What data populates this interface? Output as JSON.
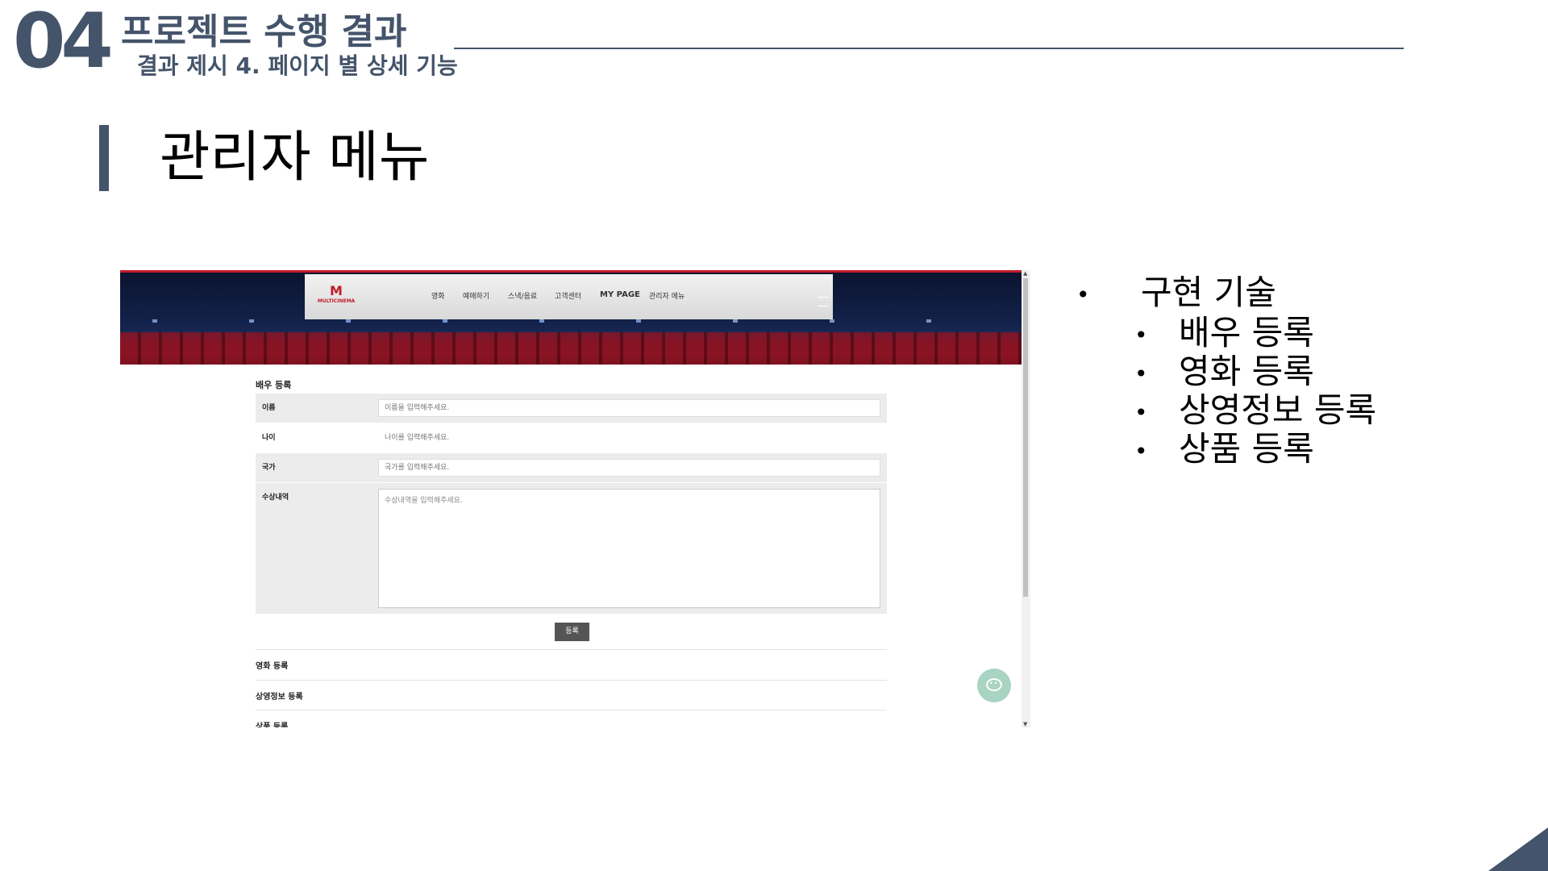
{
  "header": {
    "section_number": "04",
    "section_title": "프로젝트 수행 결과",
    "section_subtitle": "결과 제시 4. 페이지 별 상세 기능"
  },
  "slide_title": "관리자 메뉴",
  "screenshot": {
    "logo_mark": "M",
    "logo_text": "MULTICINEMA",
    "nav": [
      "영화",
      "예매하기",
      "스낵/음료",
      "고객센터",
      "MY PAGE",
      "관리자 메뉴"
    ],
    "form_title": "배우 등록",
    "fields": [
      {
        "label": "이름",
        "placeholder": "이름을 입력해주세요."
      },
      {
        "label": "나이",
        "placeholder": "나이를 입력해주세요."
      },
      {
        "label": "국가",
        "placeholder": "국가를 입력해주세요."
      },
      {
        "label": "수상내역",
        "placeholder": "수상내역을 입력해주세요."
      }
    ],
    "submit_label": "등록",
    "sections": [
      "영화 등록",
      "상영정보 등록",
      "상품 등록"
    ],
    "scroll_up": "▲",
    "scroll_down": "▼",
    "chat_dots": "•••"
  },
  "bullets": {
    "heading": "구현 기술",
    "items": [
      "배우 등록",
      "영화 등록",
      "상영정보 등록",
      "상품 등록"
    ],
    "marker": "•"
  },
  "colors": {
    "accent": "#44546a",
    "brand_red": "#c21b2b",
    "chat": "#a9d3c2"
  }
}
